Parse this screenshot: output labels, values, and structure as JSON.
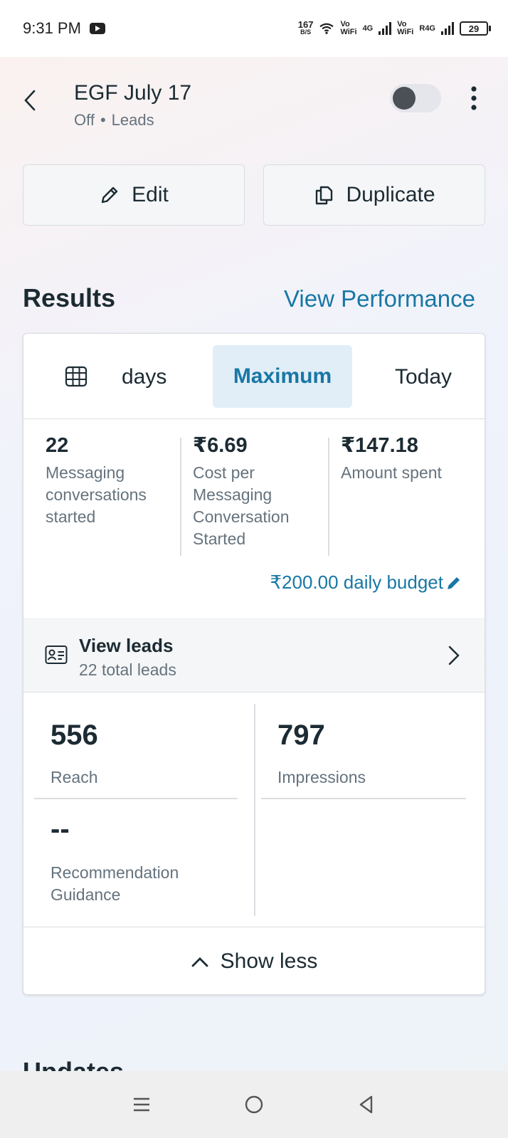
{
  "status_bar": {
    "time": "9:31 PM",
    "net_speed": "167",
    "net_speed_unit": "B/S",
    "sim1_top": "Vo",
    "sim1_bottom": "WiFi",
    "sim1_type": "4G",
    "sim2_top": "Vo",
    "sim2_bottom": "WiFi",
    "sim2_type": "R4G",
    "battery": "29"
  },
  "header": {
    "title": "EGF July 17",
    "status": "Off",
    "separator": "•",
    "objective": "Leads",
    "toggle_on": false
  },
  "actions": {
    "edit_label": "Edit",
    "duplicate_label": "Duplicate"
  },
  "results": {
    "title": "Results",
    "view_performance": "View Performance",
    "ranges": {
      "days": "days",
      "maximum": "Maximum",
      "today": "Today",
      "selected": "Maximum"
    },
    "metrics": [
      {
        "value": "22",
        "label": "Messaging conversations started"
      },
      {
        "value": "₹6.69",
        "label": "Cost per Messaging Conversation Started"
      },
      {
        "value": "₹147.18",
        "label": "Amount spent"
      }
    ],
    "budget": "₹200.00 daily budget",
    "leads": {
      "title": "View leads",
      "subtitle": "22 total leads"
    },
    "stats": {
      "reach_value": "556",
      "reach_label": "Reach",
      "impressions_value": "797",
      "impressions_label": "Impressions",
      "guidance_value": "--",
      "guidance_label": "Recommendation Guidance"
    },
    "show_less": "Show less"
  },
  "next_section_title": "Updates",
  "colors": {
    "accent": "#1877a5",
    "text": "#1c2b33",
    "muted": "#65737e",
    "selected_bg": "#e1edf7"
  }
}
